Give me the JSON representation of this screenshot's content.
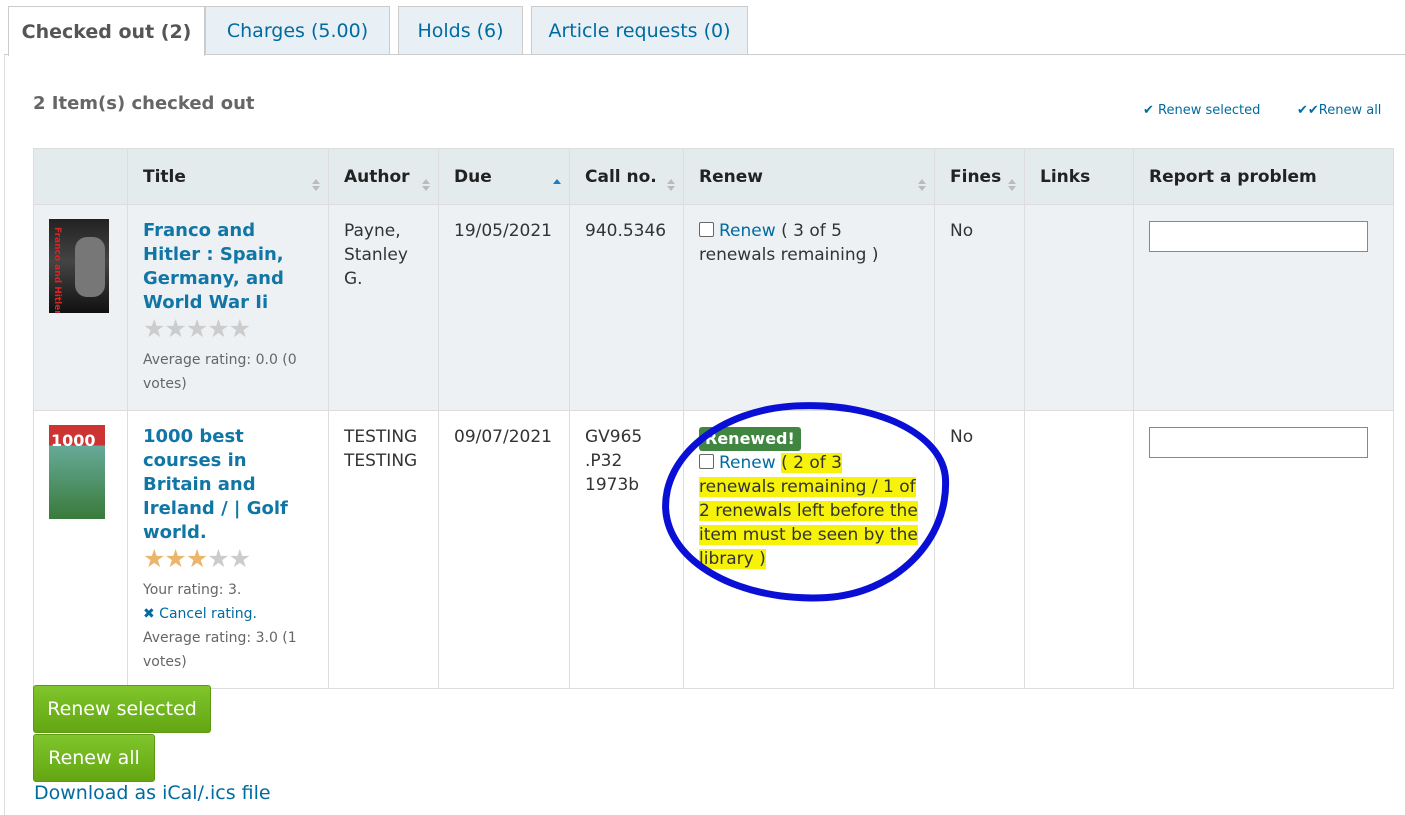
{
  "tabs": [
    {
      "label": "Checked out (2)",
      "active": true
    },
    {
      "label": "Charges (5.00)"
    },
    {
      "label": "Holds (6)"
    },
    {
      "label": "Article requests (0)"
    }
  ],
  "heading": "2 Item(s) checked out",
  "toplinks": {
    "renew_selected": "✔ Renew selected",
    "renew_all": "✔✔Renew all"
  },
  "columns": [
    "Title",
    "Author",
    "Due",
    "Call no.",
    "Renew",
    "Fines",
    "Links",
    "Report a problem"
  ],
  "rows": [
    {
      "cover_text": "Franco and Hitler",
      "title": "Franco and Hitler : Spain, Germany, and World War Ii",
      "stars": "★★★★★",
      "rating_lines": [
        "Average rating: 0.0 (0 votes)"
      ],
      "author": "Payne, Stanley G.",
      "due": "19/05/2021",
      "callno": "940.5346",
      "renew_link": "Renew",
      "renew_text": "( 3 of 5 renewals remaining )",
      "fines": "No",
      "links": ""
    },
    {
      "cover_text": "1000",
      "title": "1000 best courses in Britain and Ireland / | Golf world.",
      "stars_on": "★★★",
      "stars_off": "★★",
      "your_rating": "Your rating: 3.",
      "cancel_rating": "✖ Cancel rating.",
      "average": "Average rating: 3.0 (1 votes)",
      "author": "TESTING TESTING",
      "due": "09/07/2021",
      "callno": "GV965 .P32 1973b",
      "renewed_badge": "Renewed!",
      "renew_link": "Renew",
      "renew_text": "( 2 of 3 renewals remaining / 1 of 2 renewals left before the item must be seen by the library )",
      "fines": "No",
      "links": ""
    }
  ],
  "buttons": {
    "renew_selected": "Renew selected",
    "renew_all": "Renew all"
  },
  "ical": "Download as iCal/.ics file",
  "colors": {
    "link": "#006ba0",
    "button": "#6aaf1a",
    "renewed": "#408540",
    "highlight": "#f6f20a",
    "annotation": "#0a0fd6"
  }
}
